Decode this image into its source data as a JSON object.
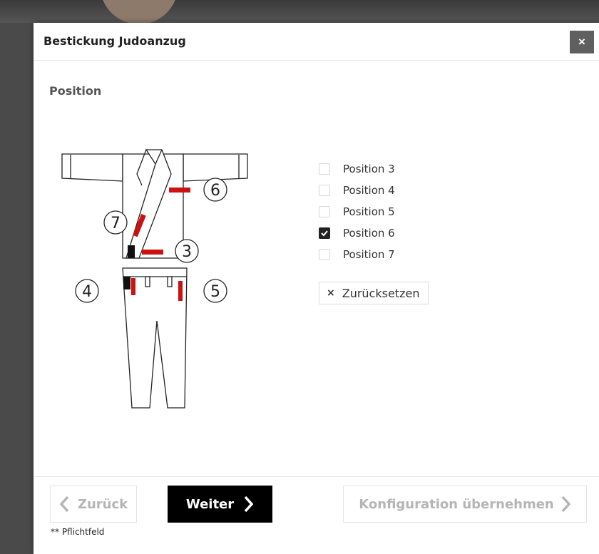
{
  "modal": {
    "title": "Bestickung Judoanzug",
    "close_label": "×"
  },
  "section": {
    "title": "Position"
  },
  "diagram": {
    "labels": [
      "6",
      "7",
      "3",
      "4",
      "5"
    ],
    "colors": {
      "outline": "#222222",
      "marker": "#cc1111",
      "belt": "#111111"
    }
  },
  "options": [
    {
      "label": "Position 3",
      "checked": false
    },
    {
      "label": "Position 4",
      "checked": false
    },
    {
      "label": "Position 5",
      "checked": false
    },
    {
      "label": "Position 6",
      "checked": true
    },
    {
      "label": "Position 7",
      "checked": false
    }
  ],
  "reset": {
    "icon": "×",
    "label": "Zurücksetzen"
  },
  "footer": {
    "back_label": "Zurück",
    "next_label": "Weiter",
    "apply_label": "Konfiguration übernehmen",
    "required_note": "** Pflichtfeld"
  },
  "colors": {
    "primary_button": "#000000",
    "disabled_text": "#b5b5b5",
    "close_button": "#5f5f5f"
  }
}
